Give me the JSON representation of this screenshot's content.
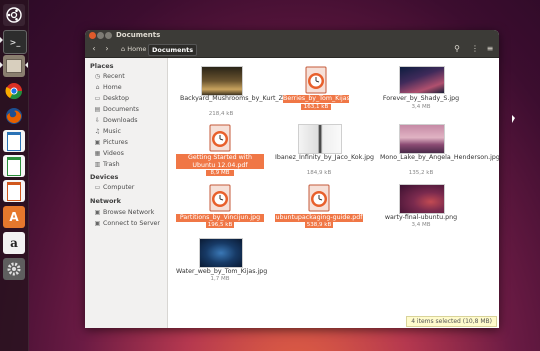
{
  "window": {
    "title": "Documents"
  },
  "toolbar": {
    "home_label": "Home",
    "current_label": "Documents"
  },
  "sidebar": {
    "places_header": "Places",
    "places": [
      {
        "label": "Recent",
        "icon": "clock-icon"
      },
      {
        "label": "Home",
        "icon": "home-icon"
      },
      {
        "label": "Desktop",
        "icon": "desktop-icon"
      },
      {
        "label": "Documents",
        "icon": "folder-icon"
      },
      {
        "label": "Downloads",
        "icon": "download-icon"
      },
      {
        "label": "Music",
        "icon": "music-icon"
      },
      {
        "label": "Pictures",
        "icon": "pictures-icon"
      },
      {
        "label": "Videos",
        "icon": "video-icon"
      },
      {
        "label": "Trash",
        "icon": "trash-icon"
      }
    ],
    "devices_header": "Devices",
    "devices": [
      {
        "label": "Computer",
        "icon": "computer-icon"
      }
    ],
    "network_header": "Network",
    "network": [
      {
        "label": "Browse Network",
        "icon": "network-icon"
      },
      {
        "label": "Connect to Server",
        "icon": "server-icon"
      }
    ]
  },
  "files": [
    {
      "name": "Backyard_Mushrooms_by_Kurt_Zitzelman.jpg",
      "size": "218,4 kB",
      "selected": false
    },
    {
      "name": "Berries_by_Tom_Kijas.jpg",
      "size": "163,1 kB",
      "selected": true
    },
    {
      "name": "Forever_by_Shady_S.jpg",
      "size": "3,4 MB",
      "selected": false
    },
    {
      "name": "Getting Started with Ubuntu 12.04.pdf",
      "size": "8,9 MB",
      "selected": true
    },
    {
      "name": "Ibanez_Infinity_by_Jaco_Kok.jpg",
      "size": "184,9 kB",
      "selected": false
    },
    {
      "name": "Mono_Lake_by_Angela_Henderson.jpg",
      "size": "135,2 kB",
      "selected": false
    },
    {
      "name": "Partitions_by_Vincijun.jpg",
      "size": "196,5 kB",
      "selected": true
    },
    {
      "name": "ubuntupackaging-guide.pdf",
      "size": "538,9 kB",
      "selected": true
    },
    {
      "name": "warty-final-ubuntu.png",
      "size": "3,4 MB",
      "selected": false
    },
    {
      "name": "Water_web_by_Tom_Kijas.jpg",
      "size": "1,7 MB",
      "selected": false
    }
  ],
  "status": {
    "text": "4 items selected (10,8 MB)"
  },
  "launcher": {
    "items": [
      "ubuntu-dash-icon",
      "terminal-icon",
      "file-manager-icon",
      "chromium-icon",
      "firefox-icon",
      "libreoffice-writer-icon",
      "libreoffice-calc-icon",
      "libreoffice-impress-icon",
      "software-center-icon",
      "amazon-icon",
      "system-settings-icon"
    ]
  },
  "colors": {
    "selection": "#f07746",
    "titlebar": "#3c3b37",
    "close": "#e05a2b"
  }
}
